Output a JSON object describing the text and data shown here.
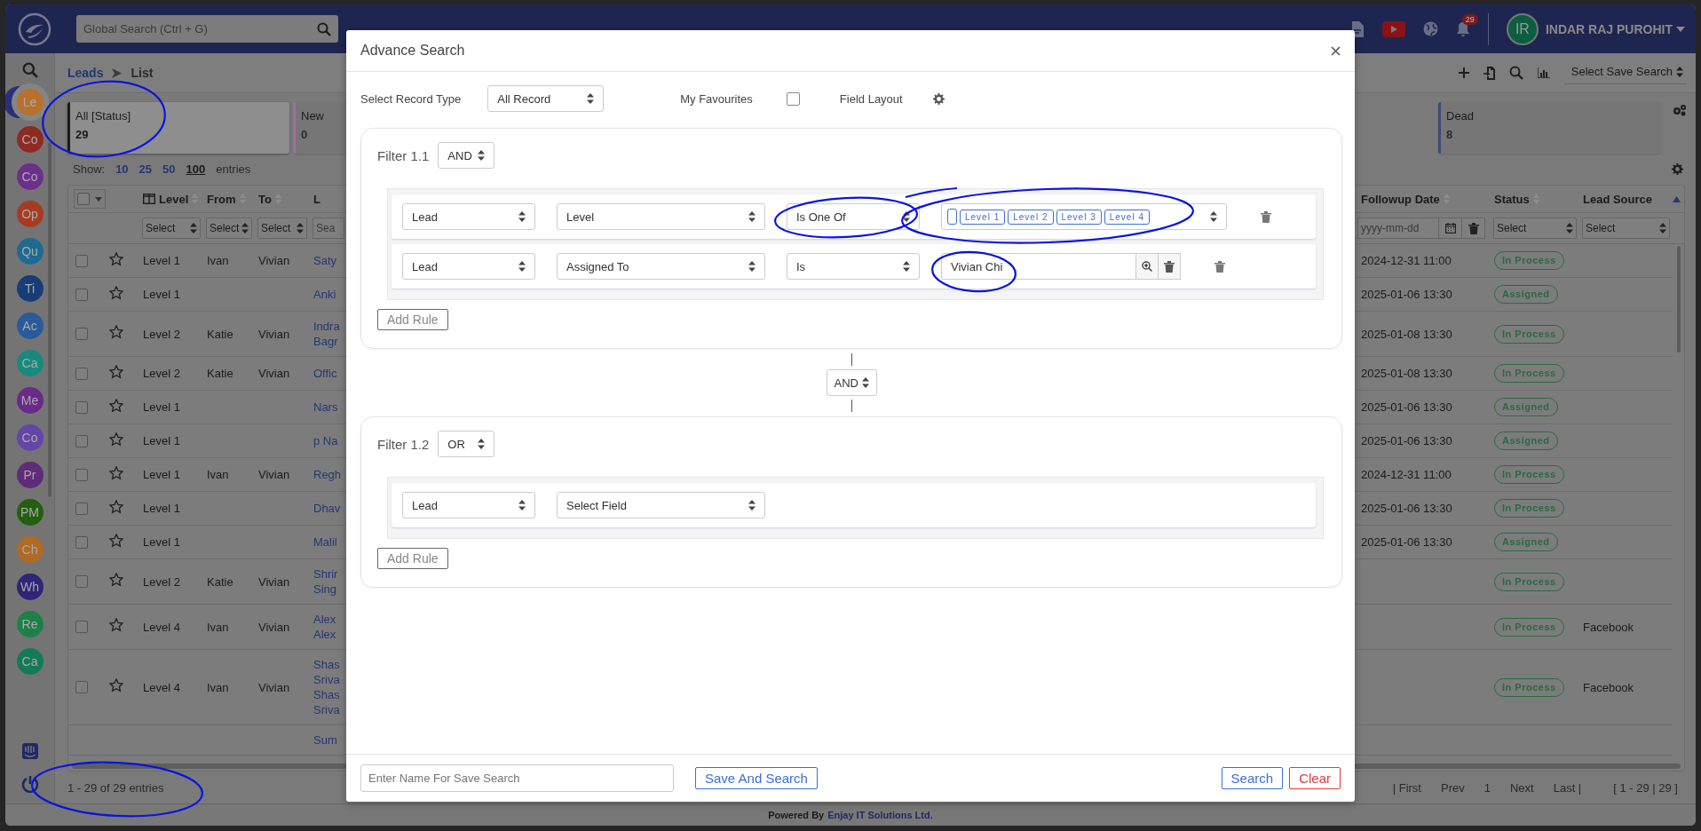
{
  "topbar": {
    "search_placeholder": "Global Search (Ctrl + G)",
    "notification_count": "29",
    "user_initials": "IR",
    "user_name": "INDAR RAJ PUROHIT"
  },
  "sidebar": {
    "items": [
      {
        "label": "Le",
        "color": "#b8702a",
        "selected": true
      },
      {
        "label": "Co",
        "color": "#8e2a22",
        "selected": false
      },
      {
        "label": "Co",
        "color": "#6c2f8a",
        "selected": false
      },
      {
        "label": "Op",
        "color": "#a83a22",
        "selected": false
      },
      {
        "label": "Qu",
        "color": "#1f6a90",
        "selected": false
      },
      {
        "label": "Ti",
        "color": "#163d78",
        "selected": false
      },
      {
        "label": "Ac",
        "color": "#2a5a9a",
        "selected": false
      },
      {
        "label": "Ca",
        "color": "#178a7e",
        "selected": false
      },
      {
        "label": "Me",
        "color": "#6a2a88",
        "selected": false
      },
      {
        "label": "Co",
        "color": "#6445a8",
        "selected": false
      },
      {
        "label": "Pr",
        "color": "#5e2c7a",
        "selected": false
      },
      {
        "label": "PM",
        "color": "#235f0e",
        "selected": false
      },
      {
        "label": "Ch",
        "color": "#b06a22",
        "selected": false
      },
      {
        "label": "Wh",
        "color": "#2e2478",
        "selected": false
      },
      {
        "label": "Re",
        "color": "#1e8048",
        "selected": false
      },
      {
        "label": "Ca",
        "color": "#137a58",
        "selected": false
      }
    ]
  },
  "breadcrumb": [
    "Leads",
    "List"
  ],
  "toolbar": {
    "save_search": "Select Save Search"
  },
  "status_cards_left": [
    {
      "label": "All [Status]",
      "count": "29",
      "color": "#1c1c1c",
      "selected": true
    },
    {
      "label": "New",
      "count": "0",
      "color": "#a070a0",
      "selected": false
    }
  ],
  "status_cards_right": [
    {
      "label": "Dead",
      "count": "8",
      "color": "#404a78",
      "selected": false
    }
  ],
  "page_size": {
    "label": "Show:",
    "options": [
      {
        "label": "10",
        "selected": false
      },
      {
        "label": "25",
        "selected": false
      },
      {
        "label": "50",
        "selected": false
      },
      {
        "label": "100",
        "selected": true
      }
    ],
    "suffix": "entries"
  },
  "table": {
    "select_all_checked": false,
    "columns_left": [
      "Level",
      "From",
      "To",
      "L"
    ],
    "columns_right": [
      "Followup Date",
      "Status",
      "Lead Source"
    ],
    "filters_left": [
      {
        "kind": "select",
        "text": "Select"
      },
      {
        "kind": "select",
        "text": "Select"
      },
      {
        "kind": "select",
        "text": "Select"
      },
      {
        "kind": "search",
        "placeholder": "Sea"
      }
    ],
    "filters_right": [
      {
        "kind": "date",
        "placeholder": "yyyy-mm-dd"
      },
      {
        "kind": "select",
        "text": "Select"
      },
      {
        "kind": "select",
        "text": "Select"
      }
    ],
    "rows": [
      {
        "checked": false,
        "favourite": false,
        "level": "Level 1",
        "from": "Ivan",
        "to": "Vivian",
        "name": [
          "Saty"
        ],
        "followup": "2024-12-31 11:00",
        "status": "In Process"
      },
      {
        "checked": false,
        "favourite": false,
        "level": "Level 1",
        "name": [
          "Anki"
        ],
        "followup": "2025-01-06 13:30",
        "status": "Assigned"
      },
      {
        "checked": false,
        "favourite": false,
        "level": "Level 2",
        "from": "Katie",
        "to": "Vivian",
        "name": [
          "Indra",
          "Bagr"
        ],
        "followup": "2025-01-08 13:30",
        "status": "In Process"
      },
      {
        "checked": false,
        "favourite": false,
        "level": "Level 2",
        "from": "Katie",
        "to": "Vivian",
        "name": [
          "Offic"
        ],
        "followup": "2025-01-08 13:30",
        "status": "In Process"
      },
      {
        "checked": false,
        "favourite": false,
        "level": "Level 1",
        "name": [
          "Nars"
        ],
        "followup": "2025-01-06 13:30",
        "status": "Assigned"
      },
      {
        "checked": false,
        "favourite": false,
        "level": "Level 1",
        "name": [
          "p Na"
        ],
        "followup": "2025-01-06 13:30",
        "status": "Assigned"
      },
      {
        "checked": false,
        "favourite": false,
        "level": "Level 1",
        "from": "Ivan",
        "to": "Vivian",
        "name": [
          "Regh"
        ],
        "followup": "2024-12-31 11:00",
        "status": "In Process"
      },
      {
        "checked": false,
        "favourite": false,
        "level": "Level 1",
        "name": [
          "Dhav"
        ],
        "followup": "2025-01-06 13:30",
        "status": "In Process"
      },
      {
        "checked": false,
        "favourite": false,
        "level": "Level 1",
        "name": [
          "Malil"
        ],
        "followup": "2025-01-06 13:30",
        "status": "Assigned"
      },
      {
        "checked": false,
        "favourite": false,
        "level": "Level 2",
        "from": "Katie",
        "to": "Vivian",
        "name": [
          "Shrir",
          "Sing"
        ],
        "status": "In Process"
      },
      {
        "checked": false,
        "favourite": false,
        "level": "Level 4",
        "from": "Ivan",
        "to": "Vivian",
        "name": [
          "Alex",
          "Alex"
        ],
        "status": "In Process",
        "source": "Facebook"
      },
      {
        "checked": false,
        "favourite": false,
        "level": "Level 4",
        "from": "Ivan",
        "to": "Vivian",
        "name": [
          "Shas",
          "Sriva",
          "Shas",
          "Sriva"
        ],
        "status": "In Process",
        "source": "Facebook"
      },
      {
        "name": [
          "Sum"
        ]
      }
    ]
  },
  "footer": {
    "summary": "1 - 29 of 29 entries",
    "pager": [
      "| First",
      "Prev",
      "1",
      "Next",
      "Last |"
    ],
    "range": "[ 1 - 29 | 29 ]"
  },
  "powered_by": {
    "text": "Powered By",
    "link": "Enjay IT Solutions Ltd."
  },
  "modal": {
    "title": "Advance Search",
    "record_type_label": "Select Record Type",
    "record_type": "All Record",
    "favourites_label": "My Favourites",
    "favourites_checked": false,
    "field_layout_label": "Field Layout",
    "filters": [
      {
        "title": "Filter 1.1",
        "operator": "AND",
        "add_rule": "Add Rule",
        "rules": [
          {
            "kind": "tags",
            "module": "Lead",
            "field": "Level",
            "operator": "Is One Of",
            "tags": [
              "Level 1",
              "Level 2",
              "Level 3",
              "Level 4"
            ]
          },
          {
            "kind": "text",
            "module": "Lead",
            "field": "Assigned To",
            "operator": "Is",
            "value": "Vivian Chi"
          }
        ]
      },
      {
        "title": "Filter 1.2",
        "operator": "OR",
        "add_rule": "Add Rule",
        "rules": [
          {
            "kind": "field",
            "module": "Lead",
            "field": "Select Field"
          }
        ]
      }
    ],
    "joiners": [
      "AND"
    ],
    "save_name_placeholder": "Enter Name For Save Search",
    "save_and_search": "Save And Search",
    "search": "Search",
    "clear": "Clear"
  }
}
